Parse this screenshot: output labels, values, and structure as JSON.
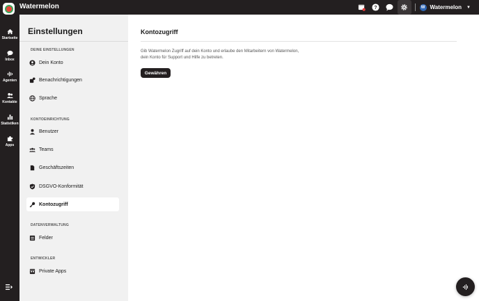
{
  "app": {
    "title": "Watermelon"
  },
  "topbar": {
    "account_name": "Watermelon",
    "account_initial": "W"
  },
  "rail": {
    "items": [
      {
        "label": "Startseite",
        "icon": "home-icon"
      },
      {
        "label": "Inbox",
        "icon": "inbox-icon"
      },
      {
        "label": "Agenten",
        "icon": "agents-icon"
      },
      {
        "label": "Kontakte",
        "icon": "contacts-icon"
      },
      {
        "label": "Statistiken",
        "icon": "stats-icon"
      },
      {
        "label": "Apps",
        "icon": "puzzle-icon"
      }
    ]
  },
  "settings": {
    "title": "Einstellungen",
    "sections": [
      {
        "heading": "DEINE EINSTELLUNGEN"
      },
      {
        "heading": "KONTOEINRICHTUNG"
      },
      {
        "heading": "DATENVERWALTUNG"
      },
      {
        "heading": "ENTWICKLER"
      }
    ],
    "items": [
      {
        "label": "Dein Konto",
        "icon": "user-circle-icon"
      },
      {
        "label": "Benachrichtigungen",
        "icon": "bell-icon"
      },
      {
        "label": "Sprache",
        "icon": "globe-icon"
      },
      {
        "label": "Benutzer",
        "icon": "person-icon"
      },
      {
        "label": "Teams",
        "icon": "team-icon"
      },
      {
        "label": "Geschäftszeiten",
        "icon": "document-icon"
      },
      {
        "label": "DSGVO-Konformität",
        "icon": "shield-icon"
      },
      {
        "label": "Kontozugriff",
        "icon": "key-icon"
      },
      {
        "label": "Felder",
        "icon": "list-icon"
      },
      {
        "label": "Private Apps",
        "icon": "apps-icon"
      }
    ]
  },
  "main": {
    "title": "Kontozugriff",
    "description": "Gib Watermelon Zugriff auf dein Konto und erlaube den Mitarbeitern von Watermelon, dein Konto für Support und Hilfe zu betreten.",
    "grant_button": "Gewähren"
  },
  "colors": {
    "dark": "#231f20",
    "panel": "#f1f1f1",
    "accent_red": "#e8473d",
    "accent_green": "#3aa65b"
  }
}
